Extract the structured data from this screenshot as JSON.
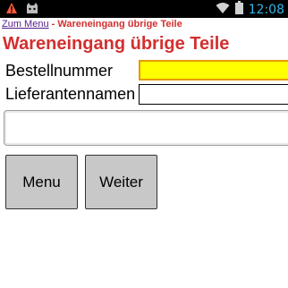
{
  "status_bar": {
    "time": "12:08",
    "icons": [
      "notification-alert-icon",
      "cat-app-icon",
      "wifi-icon",
      "battery-icon"
    ],
    "accent_color": "#33b5e5"
  },
  "breadcrumb": {
    "link_label": "Zum Menu",
    "separator": " - ",
    "current": "Wareneingang übrige Teile",
    "link_color": "#551a8b",
    "current_color": "#d32f2f"
  },
  "page": {
    "title": "Wareneingang übrige Teile",
    "title_color": "#d32f2f"
  },
  "form": {
    "order_number": {
      "label": "Bestellnummer",
      "value": "",
      "placeholder": "",
      "highlight_color": "#ffff00"
    },
    "supplier_name": {
      "label": "Lieferantennamen",
      "value": "",
      "placeholder": ""
    },
    "message_field": {
      "value": "",
      "placeholder": ""
    }
  },
  "buttons": {
    "menu_label": "Menu",
    "next_label": "Weiter",
    "background": "#c8c8c8"
  }
}
